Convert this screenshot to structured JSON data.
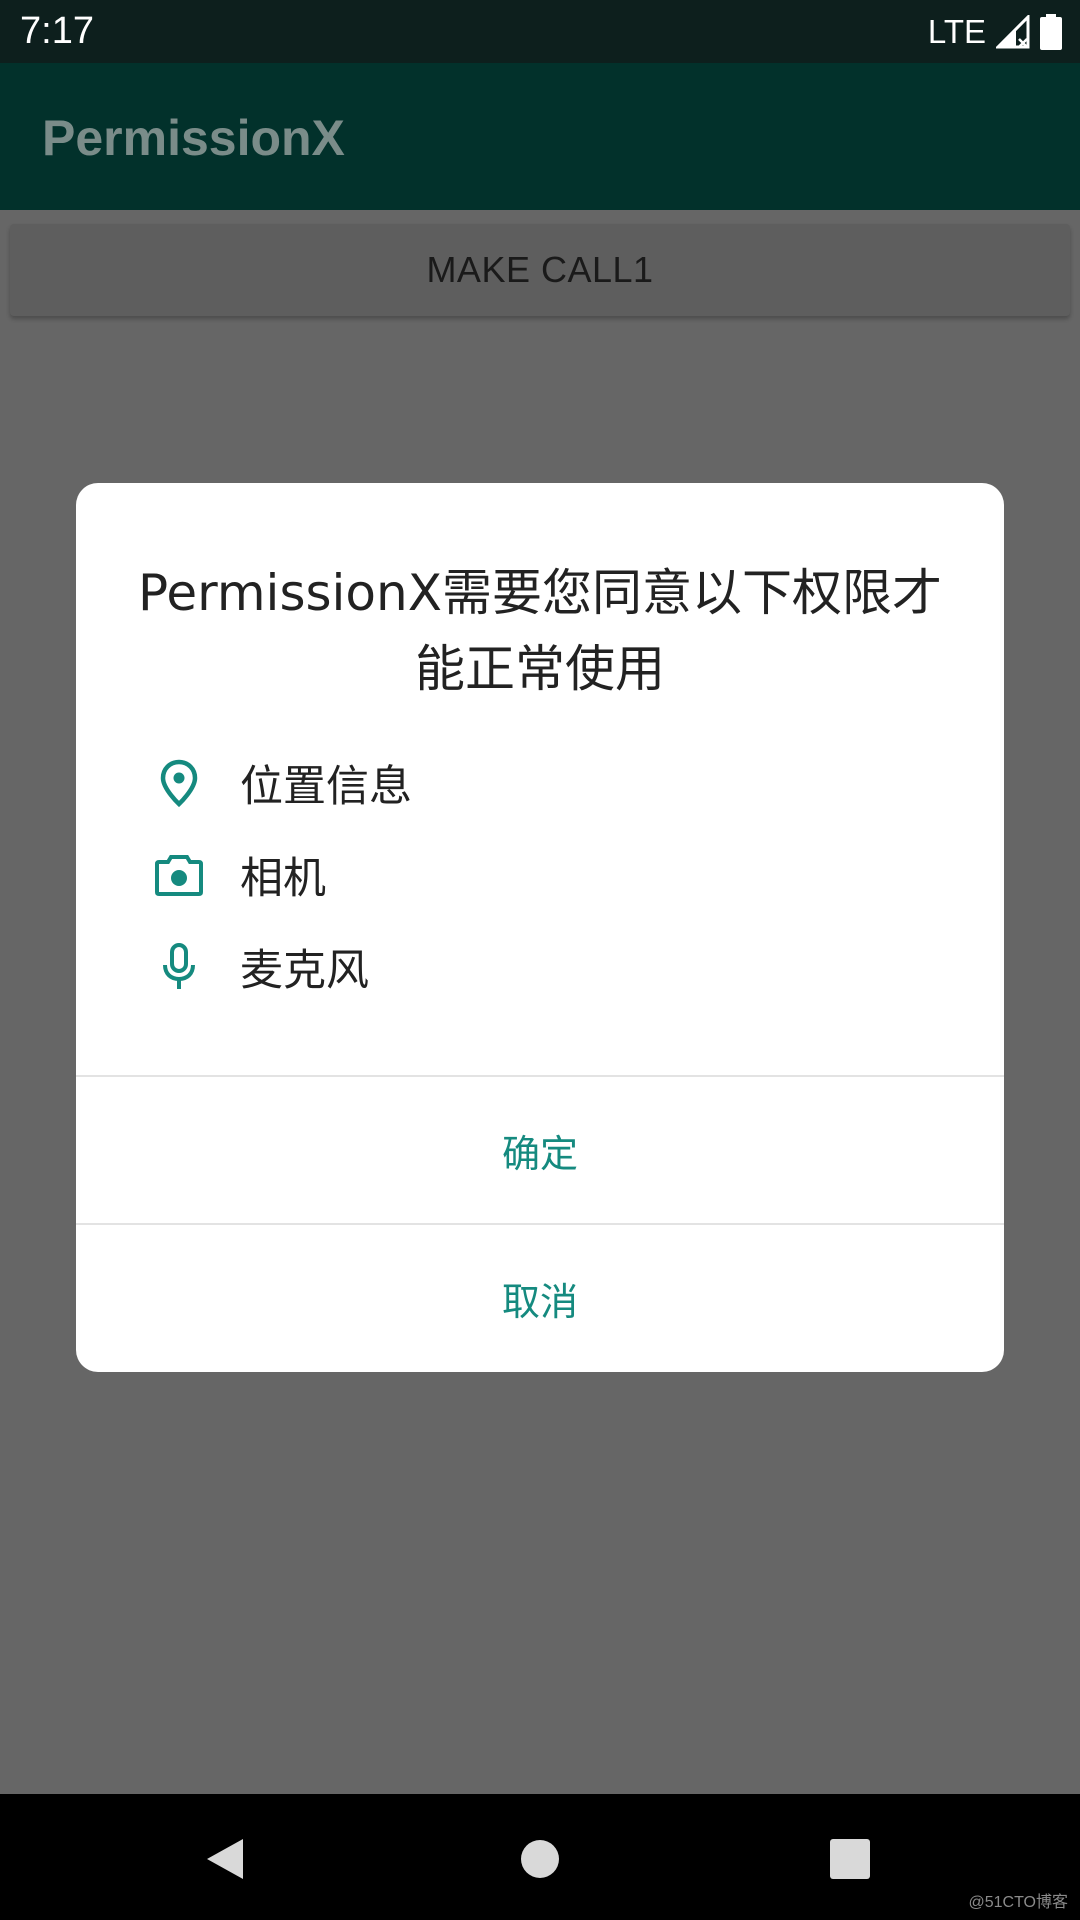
{
  "status_bar": {
    "time": "7:17",
    "network": "LTE"
  },
  "app_bar": {
    "title": "PermissionX"
  },
  "main": {
    "make_call_label": "MAKE CALL1"
  },
  "dialog": {
    "title": "PermissionX需要您同意以下权限才能正常使用",
    "permissions": [
      {
        "icon": "location-pin-icon",
        "label": "位置信息"
      },
      {
        "icon": "camera-icon",
        "label": "相机"
      },
      {
        "icon": "microphone-icon",
        "label": "麦克风"
      }
    ],
    "confirm_label": "确定",
    "cancel_label": "取消",
    "accent_color": "#158a7f"
  },
  "nav_bar": {
    "buttons": [
      "back-icon",
      "home-icon",
      "recents-icon"
    ]
  },
  "watermark": "@51CTO博客",
  "colors": {
    "status_bar": "#0d1f1d",
    "app_bar": "#02312b",
    "scrim_background": "#666666",
    "accent": "#158a7f"
  }
}
